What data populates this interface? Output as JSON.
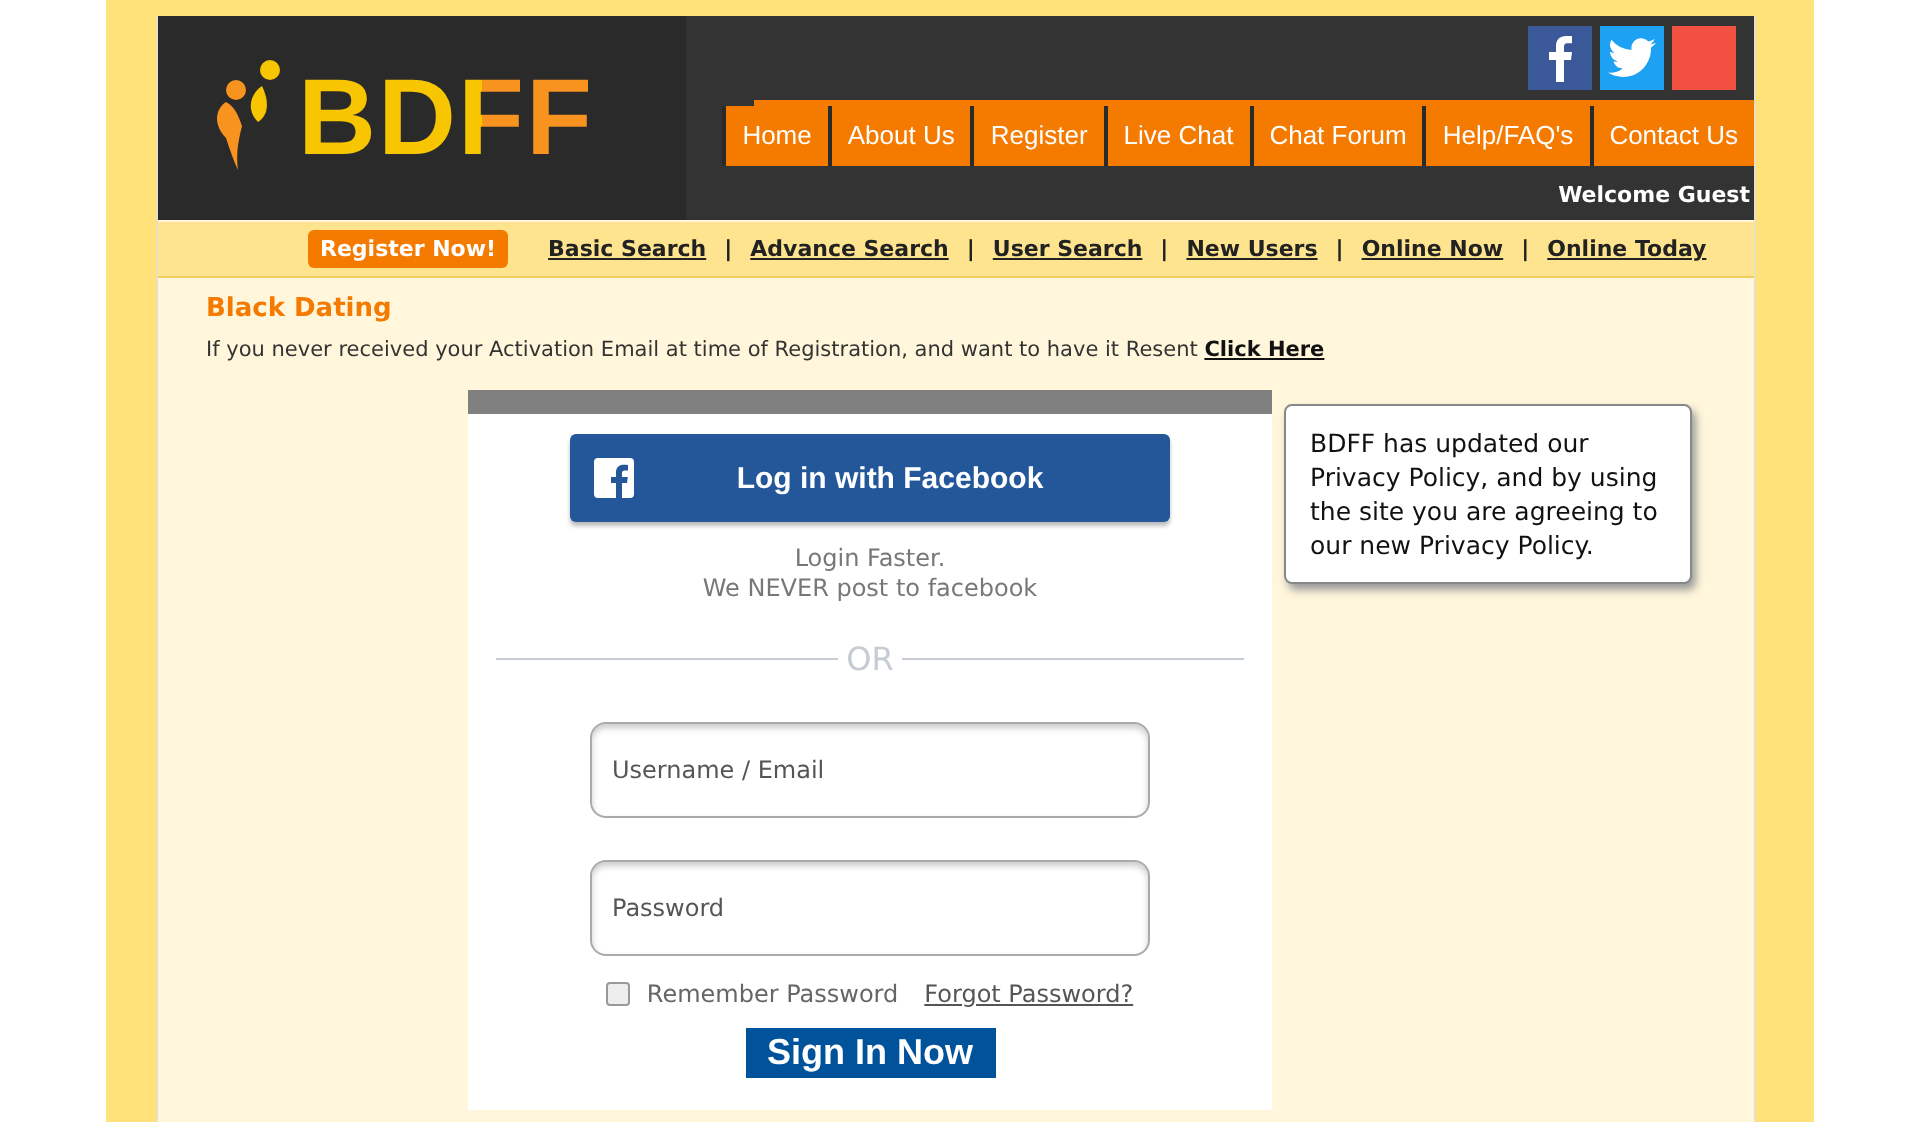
{
  "logo": {
    "text": "BDFF"
  },
  "social": [
    {
      "kind": "facebook",
      "color": "#3b5998"
    },
    {
      "kind": "twitter",
      "color": "#1da1f2"
    },
    {
      "kind": "blank",
      "color": "#f25041"
    }
  ],
  "nav": [
    {
      "label": "Home"
    },
    {
      "label": "About Us"
    },
    {
      "label": "Register"
    },
    {
      "label": "Live Chat"
    },
    {
      "label": "Chat Forum"
    },
    {
      "label": "Help/FAQ's"
    },
    {
      "label": "Contact Us"
    }
  ],
  "welcome": "Welcome Guest",
  "subnav": {
    "register_button": "Register Now!",
    "links": [
      "Basic Search",
      "Advance Search",
      "User Search",
      "New Users",
      "Online Now",
      "Online Today"
    ],
    "separator": "|"
  },
  "heading": "Black Dating",
  "activation": {
    "text": "If you never received your Activation Email at time of Registration, and want to have it Resent",
    "link": "Click Here"
  },
  "login": {
    "facebook_button": "Log in with Facebook",
    "faster": "Login Faster.",
    "never_post": "We NEVER post to facebook",
    "divider": "OR",
    "username": {
      "placeholder": "Username / Email"
    },
    "password": {
      "placeholder": "Password"
    },
    "remember": {
      "label": "Remember Password",
      "checked": false
    },
    "forgot": "Forgot Password?",
    "submit": "Sign In Now"
  },
  "notice": "BDFF has updated our Privacy Policy, and by using the site you are agreeing to our new Privacy Policy."
}
